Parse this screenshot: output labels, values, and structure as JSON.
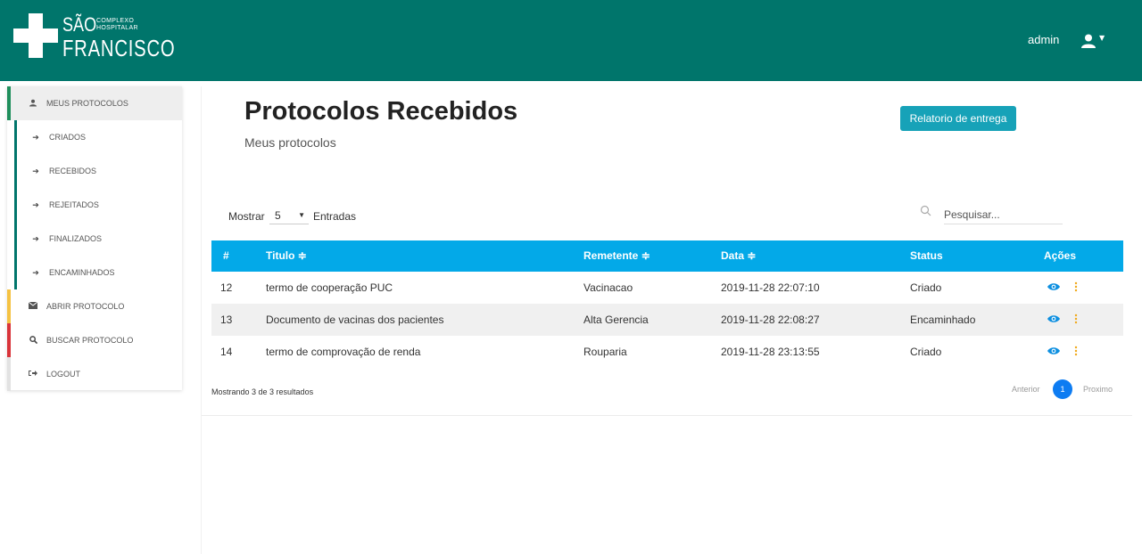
{
  "header": {
    "logo": {
      "sao": "SÃO",
      "complexo_line1": "COMPLEXO",
      "complexo_line2": "HOSPITALAR",
      "francisco": "FRANCISCO"
    },
    "user_name": "admin",
    "user_icon": "user-icon",
    "colors": {
      "bar": "#00756b"
    }
  },
  "sidebar": {
    "items": [
      {
        "label": "MEUS PROTOCOLOS",
        "icon": "user-icon"
      },
      {
        "label": "CRIADOS",
        "icon": "arrow-right-icon"
      },
      {
        "label": "RECEBIDOS",
        "icon": "arrow-right-icon"
      },
      {
        "label": "REJEITADOS",
        "icon": "arrow-right-icon"
      },
      {
        "label": "FINALIZADOS",
        "icon": "arrow-right-icon"
      },
      {
        "label": "ENCAMINHADOS",
        "icon": "arrow-right-icon"
      },
      {
        "label": "ABRIR PROTOCOLO",
        "icon": "envelope-icon"
      },
      {
        "label": "BUSCAR PROTOCOLO",
        "icon": "search-icon"
      },
      {
        "label": "LOGOUT",
        "icon": "sign-out-icon"
      }
    ]
  },
  "main": {
    "title": "Protocolos Recebidos",
    "subtitle": "Meus protocolos",
    "report_button": "Relatorio de entrega",
    "show_label": "Mostrar",
    "show_value": "5",
    "entries_label": "Entradas",
    "search_placeholder": "Pesquisar...",
    "table": {
      "headers": [
        "#",
        "Titulo ≑",
        "Remetente ≑",
        "Data ≑",
        "Status",
        "Ações"
      ],
      "rows": [
        {
          "id": "12",
          "titulo": "termo de cooperação PUC",
          "remetente": "Vacinacao",
          "data": "2019-11-28 22:07:10",
          "status": "Criado"
        },
        {
          "id": "13",
          "titulo": "Documento de vacinas dos pacientes",
          "remetente": "Alta Gerencia",
          "data": "2019-11-28 22:08:27",
          "status": "Encaminhado"
        },
        {
          "id": "14",
          "titulo": "termo de comprovação de renda",
          "remetente": "Rouparia",
          "data": "2019-11-28 23:13:55",
          "status": "Criado"
        }
      ]
    },
    "results_text": "Mostrando 3 de 3 resultados",
    "pager": {
      "prev": "Anterior",
      "page": "1",
      "next": "Proximo"
    },
    "colors": {
      "table_header": "#03a9e8",
      "button": "#17a2b8",
      "page_active": "#0d7cf2"
    }
  }
}
